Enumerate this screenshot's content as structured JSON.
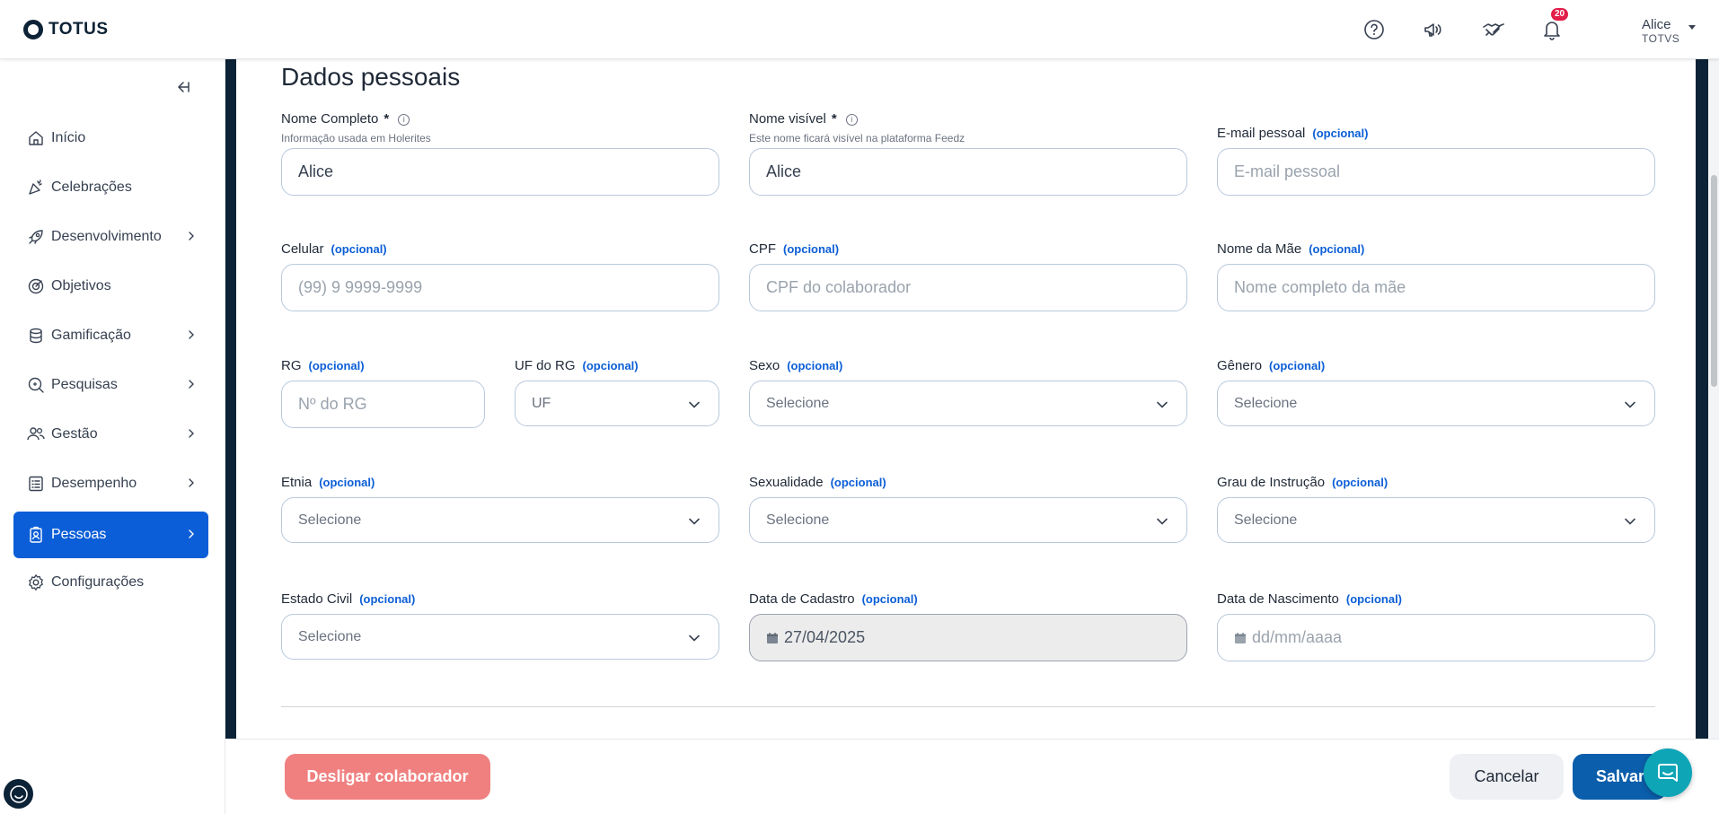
{
  "header": {
    "logo_text": "TOTUS",
    "notification_count": "20",
    "user_name": "Alice",
    "user_org": "TOTVS",
    "icons": [
      "help-icon",
      "megaphone-icon",
      "handshake-icon",
      "bell-icon"
    ]
  },
  "sidebar": {
    "items": [
      {
        "label": "Início",
        "icon": "home-icon"
      },
      {
        "label": "Celebrações",
        "icon": "party-icon"
      },
      {
        "label": "Desenvolvimento",
        "icon": "rocket-icon"
      },
      {
        "label": "Objetivos",
        "icon": "target-icon"
      },
      {
        "label": "Gamificação",
        "icon": "coins-icon"
      },
      {
        "label": "Pesquisas",
        "icon": "search-icon"
      },
      {
        "label": "Gestão",
        "icon": "people-icon"
      },
      {
        "label": "Desempenho",
        "icon": "checklist-icon"
      },
      {
        "label": "Pessoas",
        "icon": "badge-icon"
      },
      {
        "label": "Configurações",
        "icon": "gear-icon"
      }
    ],
    "active": "Pessoas"
  },
  "form": {
    "title": "Dados pessoais",
    "optional_tag": "(opcional)",
    "info_glyph": "i",
    "nome_completo": {
      "label": "Nome Completo",
      "required": "*",
      "hint": "Informação usada em Holerites",
      "value": "Alice"
    },
    "nome_visivel": {
      "label": "Nome visível",
      "required": "*",
      "hint": "Este nome ficará visível na plataforma Feedz",
      "value": "Alice"
    },
    "email": {
      "label": "E-mail pessoal",
      "placeholder": "E-mail pessoal"
    },
    "celular": {
      "label": "Celular",
      "placeholder": "(99) 9 9999-9999"
    },
    "cpf": {
      "label": "CPF",
      "placeholder": "CPF do colaborador"
    },
    "mae": {
      "label": "Nome da Mãe",
      "placeholder": "Nome completo da mãe"
    },
    "rg": {
      "label": "RG",
      "placeholder": "Nº do RG"
    },
    "uf_rg": {
      "label": "UF do RG",
      "value": "UF"
    },
    "sexo": {
      "label": "Sexo",
      "value": "Selecione"
    },
    "genero": {
      "label": "Gênero",
      "value": "Selecione"
    },
    "etnia": {
      "label": "Etnia",
      "value": "Selecione"
    },
    "sexualidade": {
      "label": "Sexualidade",
      "value": "Selecione"
    },
    "grau": {
      "label": "Grau de Instrução",
      "value": "Selecione"
    },
    "estado_civil": {
      "label": "Estado Civil",
      "value": "Selecione"
    },
    "data_cadastro": {
      "label": "Data de Cadastro",
      "value": "27/04/2025"
    },
    "data_nascimento": {
      "label": "Data de Nascimento",
      "placeholder": "dd/mm/aaaa"
    }
  },
  "footer": {
    "fire_label": "Desligar colaborador",
    "cancel_label": "Cancelar",
    "save_label": "Salvar"
  },
  "colors": {
    "primary": "#0b5ed7",
    "dark": "#0c2236",
    "danger_soft": "#f08080",
    "chat": "#0ea5b7"
  }
}
